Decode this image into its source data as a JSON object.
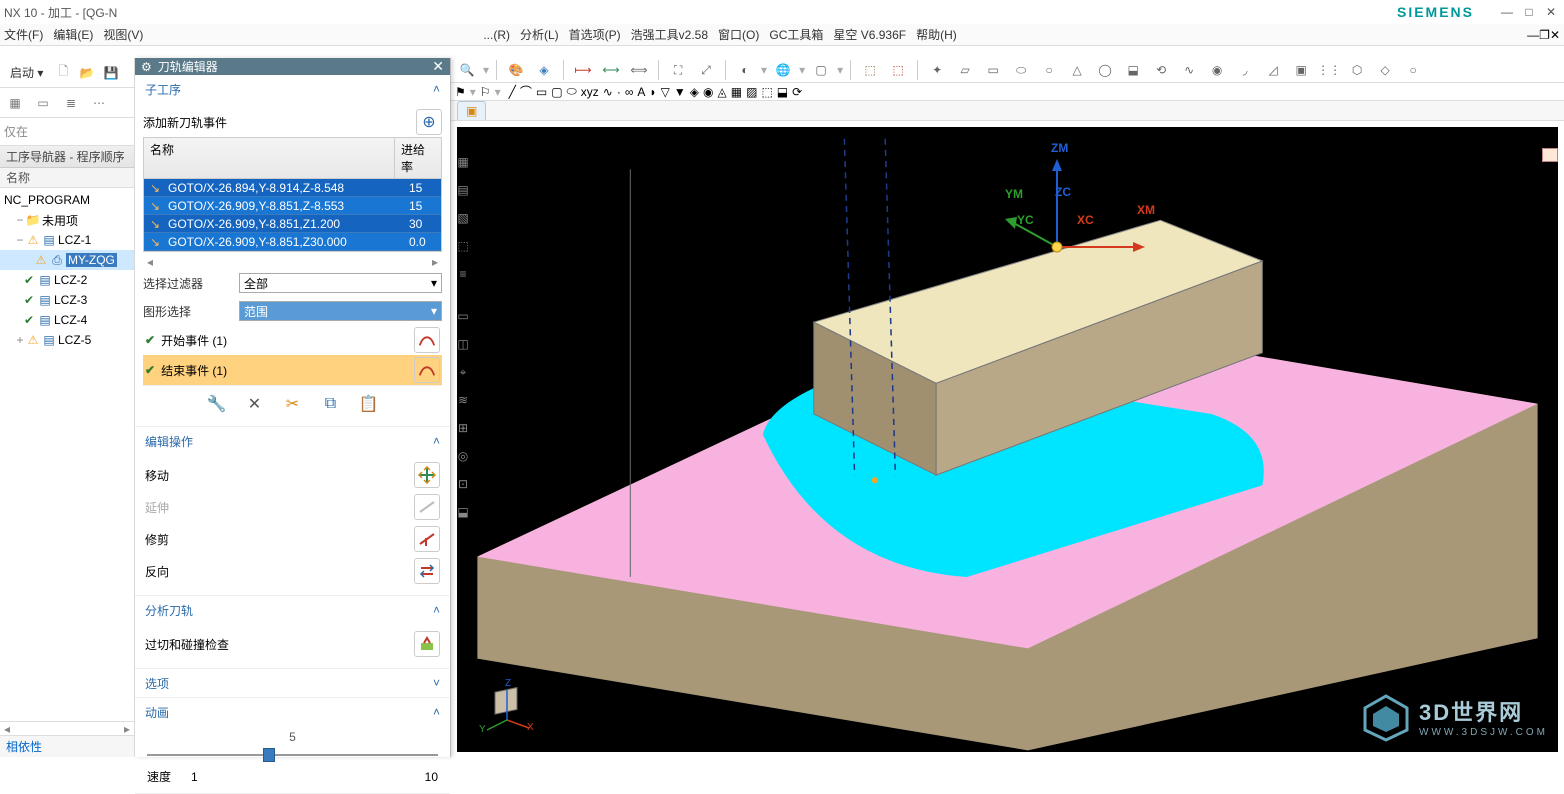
{
  "title": "NX 10 - 加工 - [QG-N",
  "brand": "SIEMENS",
  "menu": [
    "文件(F)",
    "编辑(E)",
    "视图(V)",
    "...(R)",
    "分析(L)",
    "首选项(P)",
    "浩强工具v2.58",
    "窗口(O)",
    "GC工具箱",
    "星空 V6.936F",
    "帮助(H)"
  ],
  "leftToolbar": {
    "start": "启动"
  },
  "filterRow": {
    "only": "仅在"
  },
  "navigator": {
    "header": "工序导航器 - 程序顺序",
    "colName": "名称",
    "root": "NC_PROGRAM",
    "unused": "未用项",
    "items": [
      {
        "label": "LCZ-1",
        "expand": "-",
        "status": "warn"
      },
      {
        "label": "MY-ZQG",
        "indent": true,
        "status": "warn",
        "sel": true
      },
      {
        "label": "LCZ-2",
        "status": "ok"
      },
      {
        "label": "LCZ-3",
        "status": "ok"
      },
      {
        "label": "LCZ-4",
        "status": "ok"
      },
      {
        "label": "LCZ-5",
        "expand": "+",
        "status": "warn"
      }
    ],
    "dep": "相依性"
  },
  "panel": {
    "title": "刀轨编辑器",
    "sections": {
      "subproc": "子工序",
      "addEvent": "添加新刀轨事件",
      "tableHdr": {
        "name": "名称",
        "feed": "进给率"
      },
      "rows": [
        {
          "t": "GOTO/X-26.894,Y-8.914,Z-8.548",
          "f": "15"
        },
        {
          "t": "GOTO/X-26.909,Y-8.851,Z-8.553",
          "f": "15"
        },
        {
          "t": "GOTO/X-26.909,Y-8.851,Z1.200",
          "f": "30"
        },
        {
          "t": "GOTO/X-26.909,Y-8.851,Z30.000",
          "f": "0.0"
        }
      ],
      "filterLabel": "选择过滤器",
      "filterValue": "全部",
      "graphLabel": "图形选择",
      "graphValue": "范围",
      "startEvt": "开始事件 (1)",
      "endEvt": "结束事件 (1)",
      "editOps": "编辑操作",
      "ops": {
        "move": "移动",
        "extend": "延伸",
        "trim": "修剪",
        "reverse": "反向"
      },
      "analyze": "分析刀轨",
      "gouge": "过切和碰撞检查",
      "options": "选项",
      "anim": "动画",
      "speed": "速度",
      "speedMin": "1",
      "speedMid": "5",
      "speedMax": "10"
    }
  },
  "axes": {
    "zm": "ZM",
    "ym": "YM",
    "xm": "XM",
    "zc": "ZC",
    "yc": "YC",
    "xc": "XC"
  },
  "watermark": {
    "big": "3D世界网",
    "sm": "WWW.3DSJW.COM"
  },
  "triad": {
    "x": "X",
    "y": "Y",
    "z": "Z"
  }
}
